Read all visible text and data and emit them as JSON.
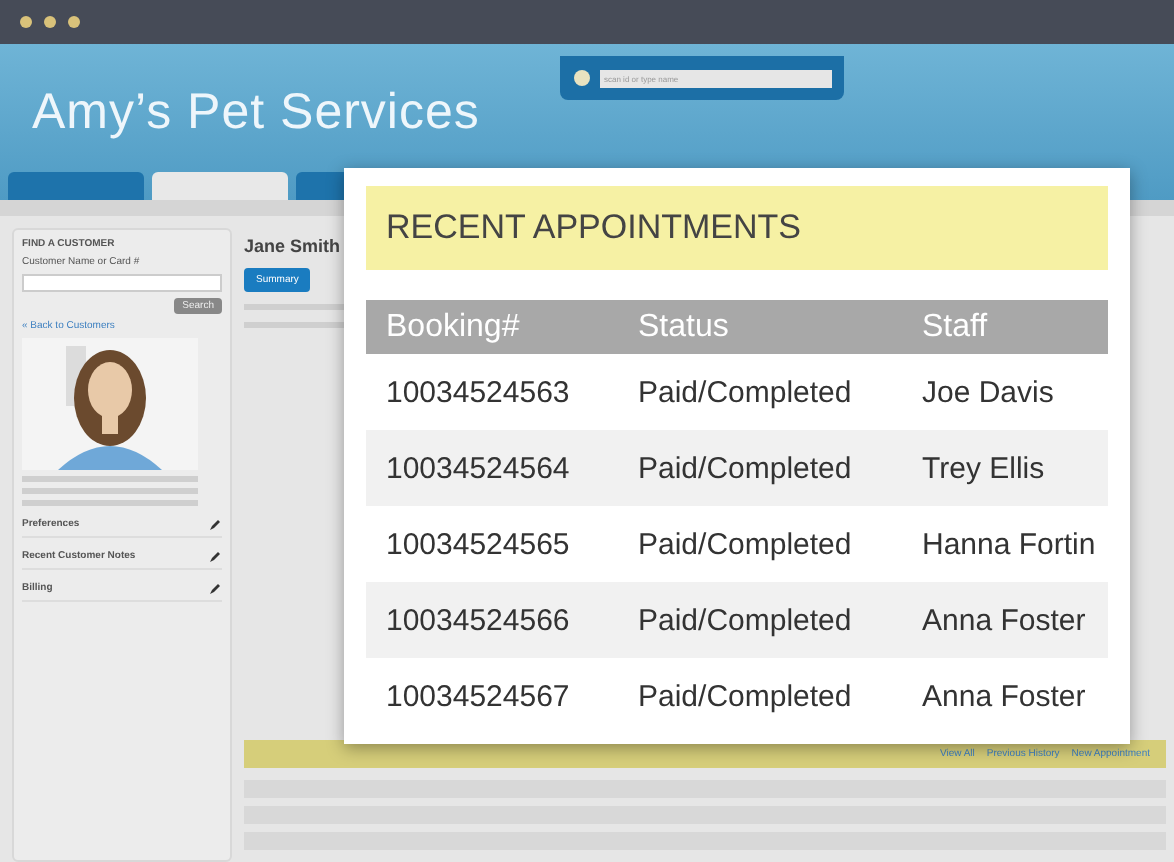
{
  "app": {
    "title": "Amy’s Pet Services",
    "search": {
      "placeholder": "scan id or type name"
    }
  },
  "nav_tabs": [
    {
      "selected": false
    },
    {
      "selected": true
    },
    {
      "selected": false
    }
  ],
  "sidebar": {
    "title": "FIND A CUSTOMER",
    "field_label": "Customer Name or Card #",
    "search_button": "Search",
    "back_link": "« Back to Customers",
    "sections": [
      "Preferences",
      "Recent Customer Notes",
      "Billing"
    ]
  },
  "customer": {
    "name": "Jane Smith",
    "tab": "Summary"
  },
  "bottom_links": [
    "View All",
    "Previous History",
    "New Appointment"
  ],
  "overlay": {
    "title": "RECENT APPOINTMENTS",
    "columns": [
      "Booking#",
      "Status",
      "Staff"
    ],
    "rows": [
      [
        "10034524563",
        "Paid/Completed",
        "Joe Davis"
      ],
      [
        "10034524564",
        "Paid/Completed",
        "Trey Ellis"
      ],
      [
        "10034524565",
        "Paid/Completed",
        "Hanna Fortin"
      ],
      [
        "10034524566",
        "Paid/Completed",
        "Anna Foster"
      ],
      [
        "10034524567",
        "Paid/Completed",
        "Anna Foster"
      ]
    ]
  }
}
